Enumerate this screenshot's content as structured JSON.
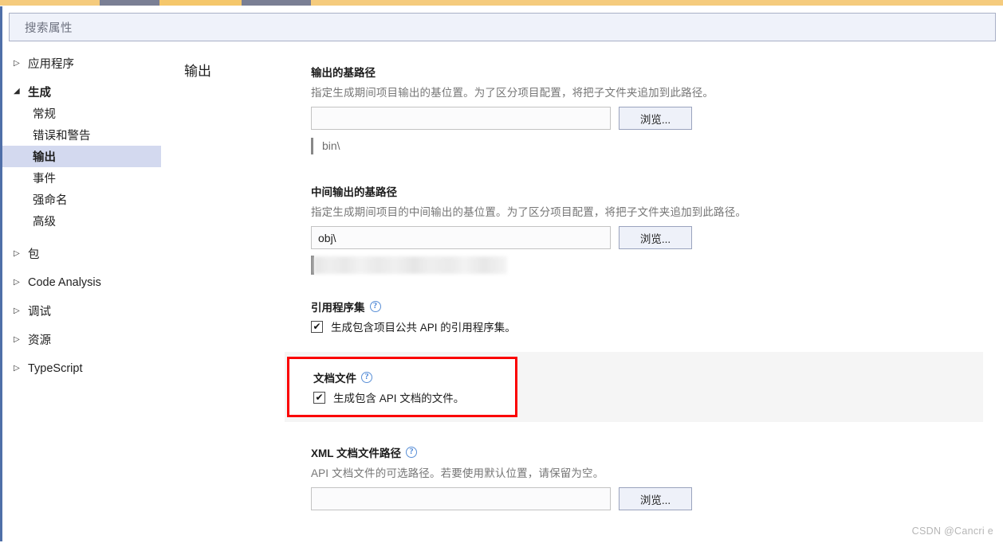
{
  "window": {
    "tabstrip_color": "#f5cb7d",
    "tabstrip_active_color": "#f5c76b",
    "rail_color": "#4f6fa8"
  },
  "search": {
    "placeholder": "搜索属性",
    "value": ""
  },
  "sidebar": {
    "items": [
      {
        "label": "应用程序",
        "level": 0,
        "state": "collapsed",
        "selected": false
      },
      {
        "label": "生成",
        "level": 0,
        "state": "expanded",
        "selected": false
      },
      {
        "label": "常规",
        "level": 1,
        "state": "leaf",
        "selected": false
      },
      {
        "label": "错误和警告",
        "level": 1,
        "state": "leaf",
        "selected": false
      },
      {
        "label": "输出",
        "level": 1,
        "state": "leaf",
        "selected": true
      },
      {
        "label": "事件",
        "level": 1,
        "state": "leaf",
        "selected": false
      },
      {
        "label": "强命名",
        "level": 1,
        "state": "leaf",
        "selected": false
      },
      {
        "label": "高级",
        "level": 1,
        "state": "leaf",
        "selected": false
      },
      {
        "label": "包",
        "level": 0,
        "state": "collapsed",
        "selected": false
      },
      {
        "label": "Code Analysis",
        "level": 0,
        "state": "collapsed",
        "selected": false
      },
      {
        "label": "调试",
        "level": 0,
        "state": "collapsed",
        "selected": false
      },
      {
        "label": "资源",
        "level": 0,
        "state": "collapsed",
        "selected": false
      },
      {
        "label": "TypeScript",
        "level": 0,
        "state": "collapsed",
        "selected": false
      }
    ]
  },
  "main": {
    "page_title": "输出",
    "browse_label": "浏览...",
    "help_glyph": "?",
    "check_glyph": "✔",
    "sections": {
      "output_base_path": {
        "label": "输出的基路径",
        "description": "指定生成期间项目输出的基位置。为了区分项目配置，将把子文件夹追加到此路径。",
        "input_value": "",
        "hint": "bin\\"
      },
      "intermediate_output_base_path": {
        "label": "中间输出的基路径",
        "description": "指定生成期间项目的中间输出的基位置。为了区分项目配置，将把子文件夹追加到此路径。",
        "input_value": "obj\\",
        "hint_redacted": true
      },
      "reference_assemblies": {
        "label": "引用程序集",
        "has_help": true,
        "checkbox_checked": true,
        "checkbox_label": "生成包含项目公共 API 的引用程序集。"
      },
      "documentation_file": {
        "label": "文档文件",
        "has_help": true,
        "checkbox_checked": true,
        "checkbox_label": "生成包含 API 文档的文件。",
        "highlighted": true,
        "highlight_color": "#fb0000",
        "band_color": "#f5f5f5"
      },
      "xml_documentation_file_path": {
        "label": "XML 文档文件路径",
        "has_help": true,
        "description": "API 文档文件的可选路径。若要使用默认位置，请保留为空。",
        "input_value": ""
      }
    }
  },
  "watermark": {
    "text": "CSDN @Cancri e"
  }
}
